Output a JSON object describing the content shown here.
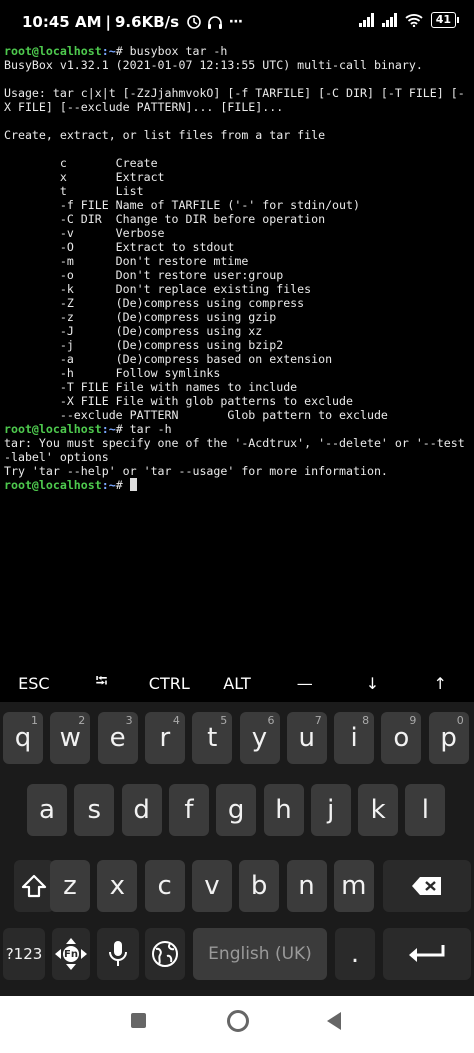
{
  "status": {
    "time": "10:45 AM",
    "separator": "|",
    "net_speed": "9.6KB/s",
    "battery": "41"
  },
  "terminal": {
    "lines": [
      {
        "user": "root@localhost",
        "path": ":~",
        "cmd": "# busybox tar -h"
      },
      {
        "text": "BusyBox v1.32.1 (2021-01-07 12:13:55 UTC) multi-call binary."
      },
      {
        "text": ""
      },
      {
        "text": "Usage: tar c|x|t [-ZzJjahmvokO] [-f TARFILE] [-C DIR] [-T FILE] [-"
      },
      {
        "text": "X FILE] [--exclude PATTERN]... [FILE]..."
      },
      {
        "text": ""
      },
      {
        "text": "Create, extract, or list files from a tar file"
      },
      {
        "text": ""
      },
      {
        "text": "        c       Create"
      },
      {
        "text": "        x       Extract"
      },
      {
        "text": "        t       List"
      },
      {
        "text": "        -f FILE Name of TARFILE ('-' for stdin/out)"
      },
      {
        "text": "        -C DIR  Change to DIR before operation"
      },
      {
        "text": "        -v      Verbose"
      },
      {
        "text": "        -O      Extract to stdout"
      },
      {
        "text": "        -m      Don't restore mtime"
      },
      {
        "text": "        -o      Don't restore user:group"
      },
      {
        "text": "        -k      Don't replace existing files"
      },
      {
        "text": "        -Z      (De)compress using compress"
      },
      {
        "text": "        -z      (De)compress using gzip"
      },
      {
        "text": "        -J      (De)compress using xz"
      },
      {
        "text": "        -j      (De)compress using bzip2"
      },
      {
        "text": "        -a      (De)compress based on extension"
      },
      {
        "text": "        -h      Follow symlinks"
      },
      {
        "text": "        -T FILE File with names to include"
      },
      {
        "text": "        -X FILE File with glob patterns to exclude"
      },
      {
        "text": "        --exclude PATTERN       Glob pattern to exclude"
      },
      {
        "user": "root@localhost",
        "path": ":~",
        "cmd": "# tar -h"
      },
      {
        "text": "tar: You must specify one of the '-Acdtrux', '--delete' or '--test"
      },
      {
        "text": "-label' options"
      },
      {
        "text": "Try 'tar --help' or 'tar --usage' for more information."
      },
      {
        "user": "root@localhost",
        "path": ":~",
        "cmd": "# ",
        "cursor": true
      }
    ]
  },
  "extra_keys": [
    "ESC",
    "⭾",
    "CTRL",
    "ALT",
    "—",
    "↓",
    "↑"
  ],
  "keyboard": {
    "row1": [
      {
        "k": "q",
        "h": "1"
      },
      {
        "k": "w",
        "h": "2"
      },
      {
        "k": "e",
        "h": "3"
      },
      {
        "k": "r",
        "h": "4"
      },
      {
        "k": "t",
        "h": "5"
      },
      {
        "k": "y",
        "h": "6"
      },
      {
        "k": "u",
        "h": "7"
      },
      {
        "k": "i",
        "h": "8"
      },
      {
        "k": "o",
        "h": "9"
      },
      {
        "k": "p",
        "h": "0"
      }
    ],
    "row2": [
      "a",
      "s",
      "d",
      "f",
      "g",
      "h",
      "j",
      "k",
      "l"
    ],
    "row3": [
      "z",
      "x",
      "c",
      "v",
      "b",
      "n",
      "m"
    ],
    "symbols_label": "?123",
    "fn_label": "Fn",
    "space_label": "English (UK)",
    "period_label": "."
  }
}
